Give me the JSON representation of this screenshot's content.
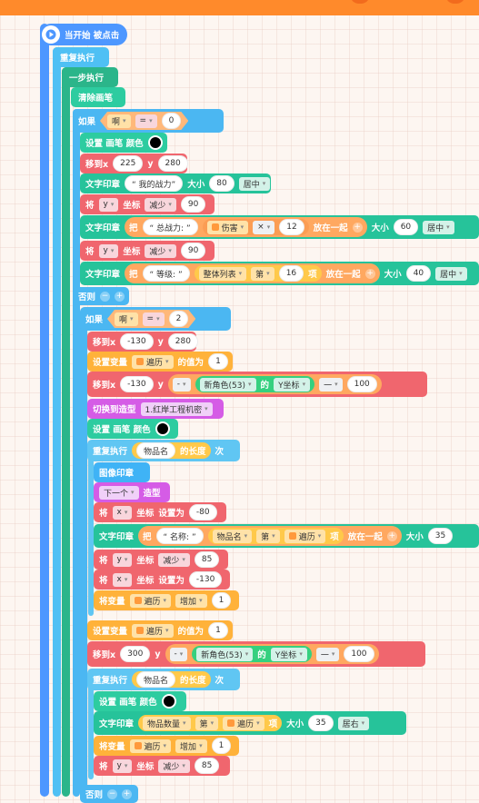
{
  "event": {
    "label": "当开始 被点击"
  },
  "loop_outer": {
    "label": "重复执行"
  },
  "step_block": {
    "label": "一步执行"
  },
  "clear_pen": {
    "label": "清除画笔"
  },
  "if1": {
    "label": "如果",
    "var": "啊",
    "op": "=",
    "value": "0",
    "else_label": "否则"
  },
  "set_pen_color_1": {
    "label": "设置 画笔 颜色",
    "color": "#000000"
  },
  "move_1": {
    "label": "移到x",
    "x": "225",
    "y_label": "y",
    "y": "280"
  },
  "text_1": {
    "label": "文字印章",
    "text": "“ 我的战力”",
    "size_label": "大小",
    "size": "80",
    "align": "居中"
  },
  "set_y_1": {
    "label": "将",
    "axis": "y",
    "coord": "坐标",
    "op": "减少",
    "value": "90"
  },
  "text_2": {
    "label": "文字印章",
    "join": "把",
    "s1": "“ 总战力: ”",
    "var": "伤害",
    "op": "×",
    "num": "12",
    "join_end": "放在一起",
    "size_label": "大小",
    "size": "60",
    "align": "居中"
  },
  "set_y_2": {
    "label": "将",
    "axis": "y",
    "coord": "坐标",
    "op": "减少",
    "value": "90"
  },
  "text_3": {
    "label": "文字印章",
    "join": "把",
    "s1": "“ 等级: ”",
    "list": "整体列表",
    "nth": "第",
    "idx": "16",
    "item": "项",
    "join_end": "放在一起",
    "size_label": "大小",
    "size": "40",
    "align": "居中"
  },
  "if2": {
    "label": "如果",
    "var": "啊",
    "op": "=",
    "value": "2"
  },
  "move_2": {
    "label": "移到x",
    "x": "-130",
    "y_label": "y",
    "y": "280"
  },
  "set_var_1": {
    "label": "设置变量",
    "var": "遍历",
    "of": "的值为",
    "value": "1"
  },
  "move_3": {
    "label": "移到x",
    "x": "-130",
    "y_label": "y",
    "op": "-",
    "sprite": "新角色(53)",
    "of": "的",
    "prop": "Y坐标",
    "op2": "一",
    "value": "100"
  },
  "switch_costume": {
    "label": "切换到造型",
    "costume": "1.红岸工程机密"
  },
  "set_pen_color_2": {
    "label": "设置 画笔 颜色",
    "color": "#000000"
  },
  "repeat_1": {
    "label": "重复执行",
    "list": "物品名",
    "len": "的长度",
    "times": "次"
  },
  "image_stamp": {
    "label": "图像印章"
  },
  "next_costume": {
    "value": "下一个",
    "label": "造型"
  },
  "set_x_1": {
    "label": "将",
    "axis": "x",
    "coord": "坐标",
    "op": "设置为",
    "value": "-80"
  },
  "text_4": {
    "label": "文字印章",
    "join": "把",
    "s1": "“ 名称: ”",
    "list": "物品名",
    "nth": "第",
    "var": "遍历",
    "item": "项",
    "join_end": "放在一起",
    "size_label": "大小",
    "size": "35"
  },
  "set_y_3": {
    "label": "将",
    "axis": "y",
    "coord": "坐标",
    "op": "减少",
    "value": "85"
  },
  "set_x_2": {
    "label": "将",
    "axis": "x",
    "coord": "坐标",
    "op": "设置为",
    "value": "-130"
  },
  "change_var_1": {
    "label": "将变量",
    "var": "遍历",
    "op": "增加",
    "value": "1"
  },
  "set_var_2": {
    "label": "设置变量",
    "var": "遍历",
    "of": "的值为",
    "value": "1"
  },
  "move_4": {
    "label": "移到x",
    "x": "300",
    "y_label": "y",
    "op": "-",
    "sprite": "新角色(53)",
    "of": "的",
    "prop": "Y坐标",
    "op2": "一",
    "value": "100"
  },
  "repeat_2": {
    "label": "重复执行",
    "list": "物品名",
    "len": "的长度",
    "times": "次"
  },
  "set_pen_color_3": {
    "label": "设置 画笔 颜色",
    "color": "#000000"
  },
  "text_5": {
    "label": "文字印章",
    "list": "物品数量",
    "nth": "第",
    "var": "遍历",
    "item": "项",
    "size_label": "大小",
    "size": "35",
    "align": "居右"
  },
  "change_var_2": {
    "label": "将变量",
    "var": "遍历",
    "op": "增加",
    "value": "1"
  },
  "set_y_4": {
    "label": "将",
    "axis": "y",
    "coord": "坐标",
    "op": "减少",
    "value": "85"
  },
  "else2": {
    "label": "否则"
  }
}
